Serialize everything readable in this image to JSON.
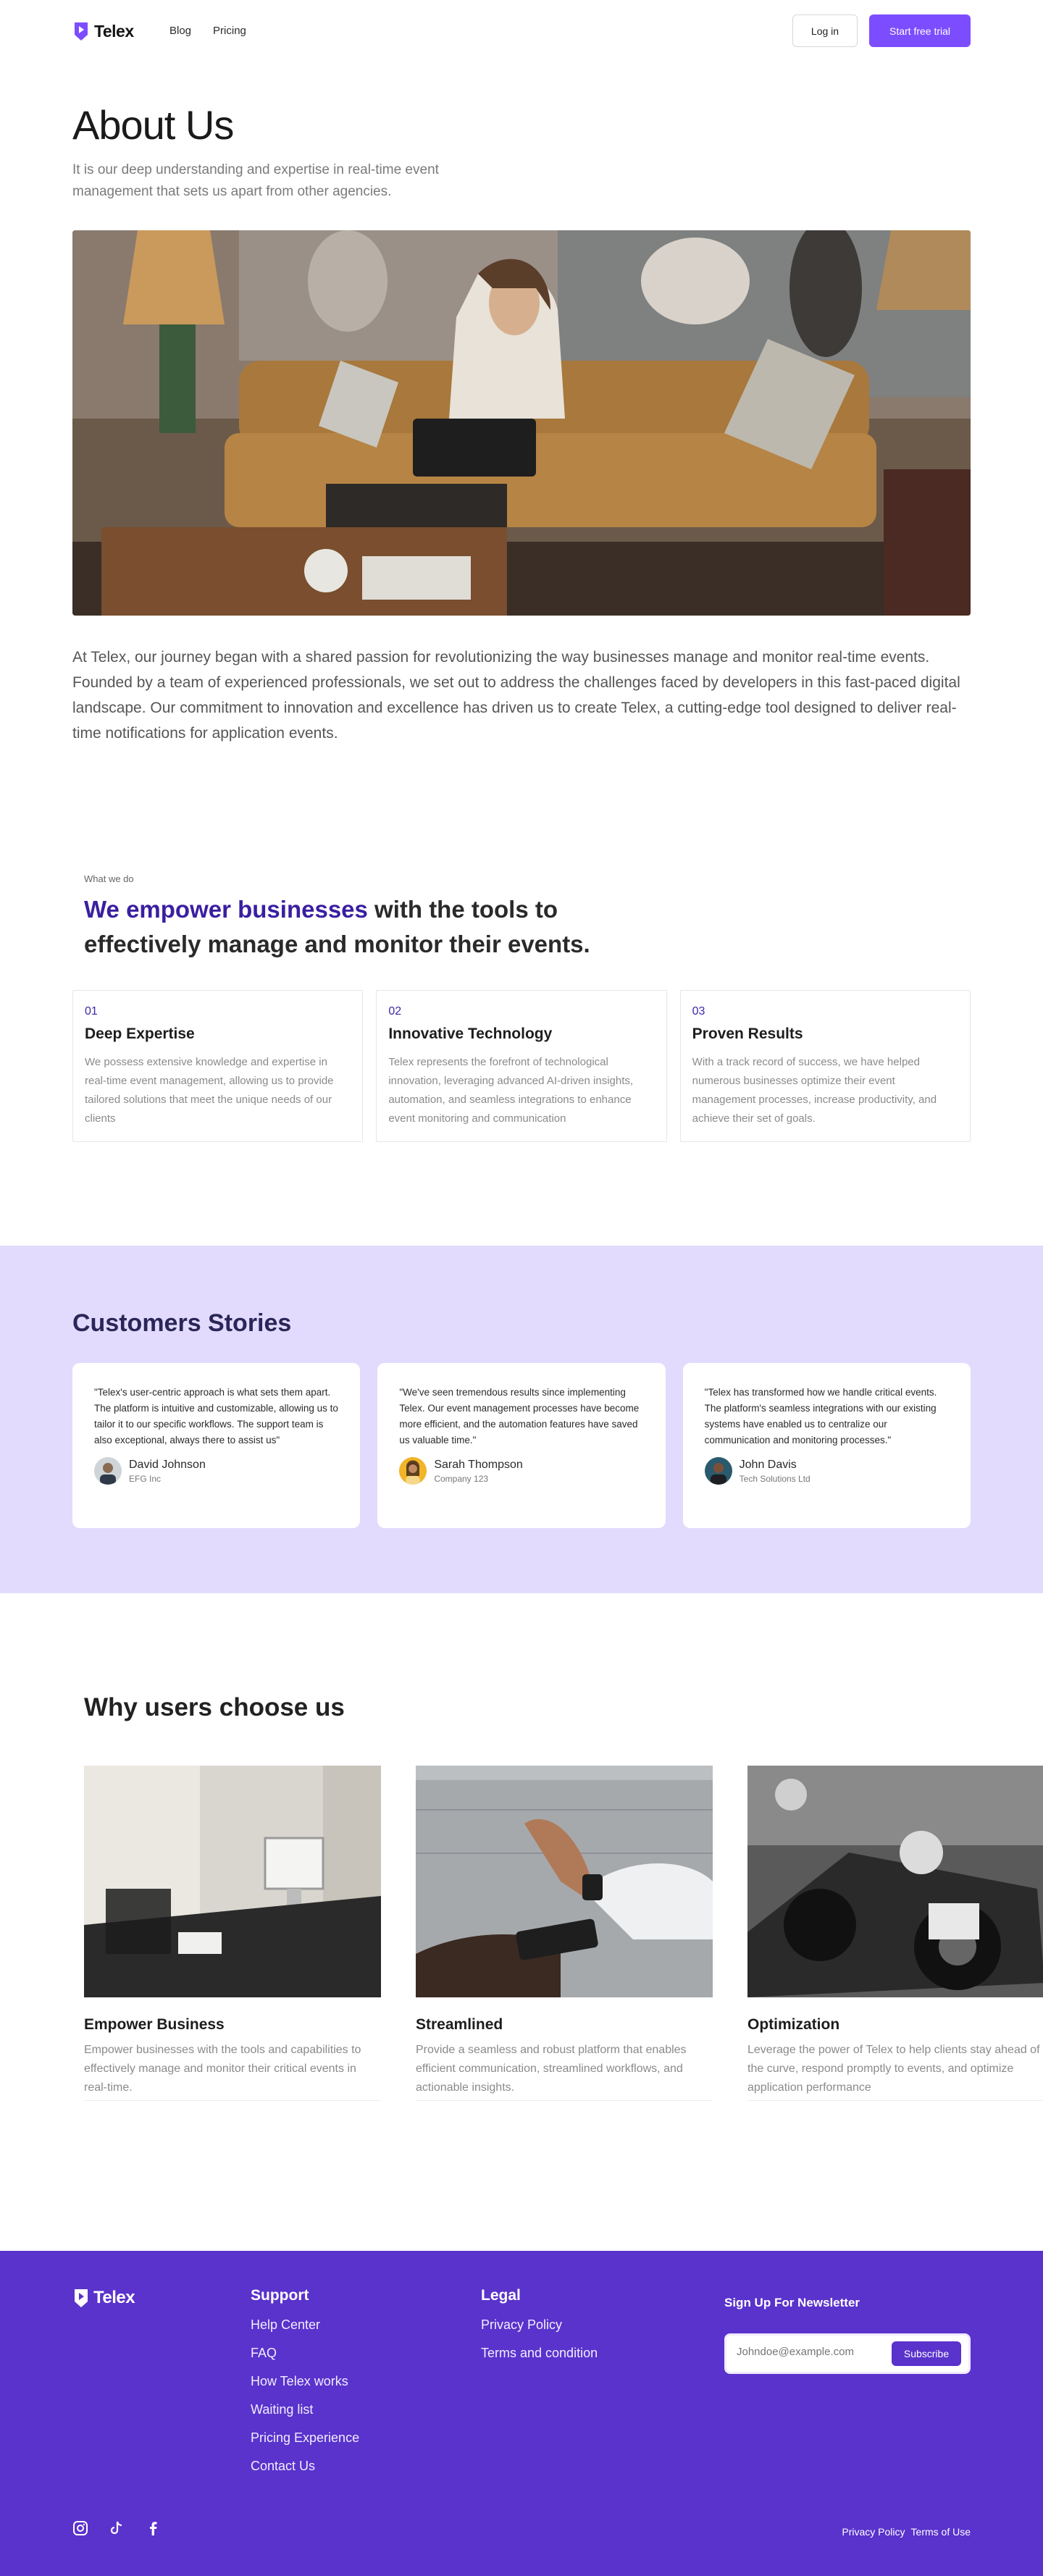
{
  "brand": {
    "name": "Telex"
  },
  "nav": {
    "links": [
      "Blog",
      "Pricing"
    ],
    "login_label": "Log in",
    "trial_label": "Start free trial"
  },
  "hero": {
    "title": "About Us",
    "subtitle": "It is our deep understanding and expertise in real-time event management that sets us apart from other agencies.",
    "body": "At Telex, our journey began with a shared passion for revolutionizing the way businesses manage and monitor real-time events. Founded by a team of experienced professionals, we set out to address the challenges faced by developers in this fast-paced digital landscape. Our commitment to innovation and excellence has driven us to create Telex, a cutting-edge tool designed to deliver real-time notifications for application events."
  },
  "what_we_do": {
    "label": "What we do",
    "heading_accent": "We empower businesses",
    "heading_rest": " with the tools to effectively manage and monitor their events.",
    "features": [
      {
        "num": "01",
        "title": "Deep Expertise",
        "desc": "We possess extensive knowledge and expertise in real-time event management, allowing us to provide tailored solutions that meet the unique needs of our clients"
      },
      {
        "num": "02",
        "title": "Innovative Technology",
        "desc": "Telex represents the forefront of technological innovation, leveraging advanced AI-driven insights, automation, and seamless integrations to enhance event monitoring and communication"
      },
      {
        "num": "03",
        "title": "Proven Results",
        "desc": " With a track record of success, we have helped numerous businesses optimize their event management processes, increase productivity, and achieve their set of goals."
      }
    ]
  },
  "customers": {
    "title": "Customers Stories",
    "stories": [
      {
        "quote": "\"Telex's user-centric approach is what sets them apart. The platform is intuitive and customizable, allowing us to tailor it to our specific workflows. The support team is also exceptional, always there to assist us\"",
        "name": "David Johnson",
        "company": "EFG Inc"
      },
      {
        "quote": "\"We've seen tremendous results since implementing Telex. Our event management processes have become more efficient, and the automation features have saved us valuable time.\"",
        "name": "Sarah Thompson",
        "company": "Company 123"
      },
      {
        "quote": "\"Telex has transformed how we handle critical events. The platform's seamless integrations with our existing systems have enabled us to centralize our communication and monitoring processes.\"",
        "name": "John Davis",
        "company": "Tech Solutions Ltd"
      }
    ]
  },
  "why": {
    "title": "Why users choose us",
    "cards": [
      {
        "title": "Empower Business",
        "desc": "Empower businesses with the tools and capabilities to effectively manage and monitor their critical events in real-time."
      },
      {
        "title": "Streamlined",
        "desc": "Provide a seamless and robust platform that enables efficient communication, streamlined workflows, and actionable insights."
      },
      {
        "title": "Optimization",
        "desc": "Leverage the power of Telex to help clients stay ahead of the curve, respond promptly to events, and optimize application performance"
      }
    ]
  },
  "footer": {
    "support_title": "Support",
    "support_links": [
      "Help Center",
      "FAQ",
      "How Telex works",
      "Waiting list",
      "Pricing Experience",
      "Contact Us"
    ],
    "legal_title": "Legal",
    "legal_links": [
      "Privacy Policy",
      "Terms and condition"
    ],
    "newsletter_title": "Sign Up For Newsletter",
    "newsletter_placeholder": "Johndoe@example.com",
    "subscribe_label": "Subscribe",
    "bottom_links": [
      "Privacy Policy",
      "Terms of Use"
    ],
    "socials": [
      "instagram-icon",
      "tiktok-icon",
      "facebook-icon"
    ]
  },
  "colors": {
    "accent": "#7c4dff",
    "footer_bg": "#5a32cc",
    "customers_bg": "#e2dbfd",
    "heading_accent": "#3a1fa0"
  }
}
